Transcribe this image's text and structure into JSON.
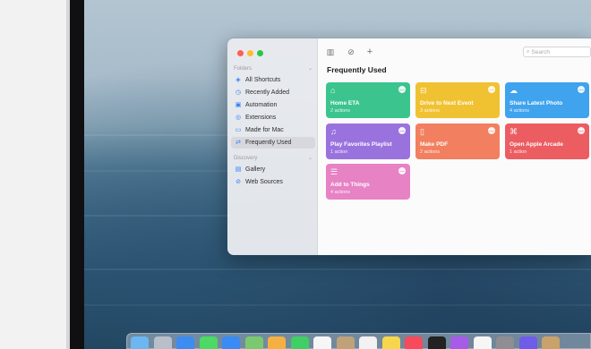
{
  "sidebar": {
    "folders_header": "Folders",
    "discovery_header": "Discovery",
    "items": [
      {
        "label": "All Shortcuts",
        "icon": "stack-icon"
      },
      {
        "label": "Recently Added",
        "icon": "clock-icon"
      },
      {
        "label": "Automation",
        "icon": "automation-icon"
      },
      {
        "label": "Extensions",
        "icon": "extensions-icon"
      },
      {
        "label": "Made for Mac",
        "icon": "laptop-icon"
      },
      {
        "label": "Frequently Used",
        "icon": "frequent-icon",
        "selected": true
      }
    ],
    "discovery_items": [
      {
        "label": "Gallery",
        "icon": "gallery-icon"
      },
      {
        "label": "Web Sources",
        "icon": "compass-icon"
      }
    ]
  },
  "toolbar": {
    "search_placeholder": "Search",
    "sidebar_toggle_icon": "sidebar-toggle-icon",
    "run_icon": "checkmark-circle-icon",
    "add_icon": "plus-icon"
  },
  "main": {
    "title": "Frequently Used",
    "cards": [
      {
        "name": "Home ETA",
        "actions": "2 actions",
        "color": "#3cc48f",
        "icon": "house-icon"
      },
      {
        "name": "Drive to Next Event",
        "actions": "3 actions",
        "color": "#f0c232",
        "icon": "car-icon"
      },
      {
        "name": "Share Latest Photo",
        "actions": "4 actions",
        "color": "#3fa3ee",
        "icon": "cloud-upload-icon"
      },
      {
        "name": "Play Favorites Playlist",
        "actions": "1 action",
        "color": "#9a72de",
        "icon": "music-sparkle-icon"
      },
      {
        "name": "Make PDF",
        "actions": "2 actions",
        "color": "#f27f5f",
        "icon": "document-icon"
      },
      {
        "name": "Open Apple Arcade",
        "actions": "1 action",
        "color": "#ec5d62",
        "icon": "gamepad-icon"
      },
      {
        "name": "Add to Things",
        "actions": "4 actions",
        "color": "#e782c4",
        "icon": "list-icon"
      }
    ]
  },
  "dock": {
    "icons": [
      {
        "icon": "finder-icon",
        "color": "#6cb6f2"
      },
      {
        "icon": "launchpad-icon",
        "color": "#b9bfc8"
      },
      {
        "icon": "safari-icon",
        "color": "#3d8cf0"
      },
      {
        "icon": "messages-icon",
        "color": "#4cd964"
      },
      {
        "icon": "mail-icon",
        "color": "#3a8bf3"
      },
      {
        "icon": "maps-icon",
        "color": "#7bc96f"
      },
      {
        "icon": "photos-icon",
        "color": "#f5b043"
      },
      {
        "icon": "facetime-icon",
        "color": "#3fcf64"
      },
      {
        "icon": "calendar-icon",
        "color": "#f6f6f6"
      },
      {
        "icon": "contacts-icon",
        "color": "#bfa27a"
      },
      {
        "icon": "reminders-icon",
        "color": "#f2f2f2"
      },
      {
        "icon": "notes-icon",
        "color": "#f7d64c"
      },
      {
        "icon": "music-icon",
        "color": "#f74a5c"
      },
      {
        "icon": "tv-icon",
        "color": "#222222"
      },
      {
        "icon": "podcasts-icon",
        "color": "#a75ce8"
      },
      {
        "icon": "news-icon",
        "color": "#f6f6f6"
      },
      {
        "icon": "settings-icon",
        "color": "#8e8e93"
      },
      {
        "icon": "shortcuts-icon",
        "color": "#6e5de8"
      },
      {
        "icon": "preview-icon",
        "color": "#c9a26b"
      }
    ]
  }
}
